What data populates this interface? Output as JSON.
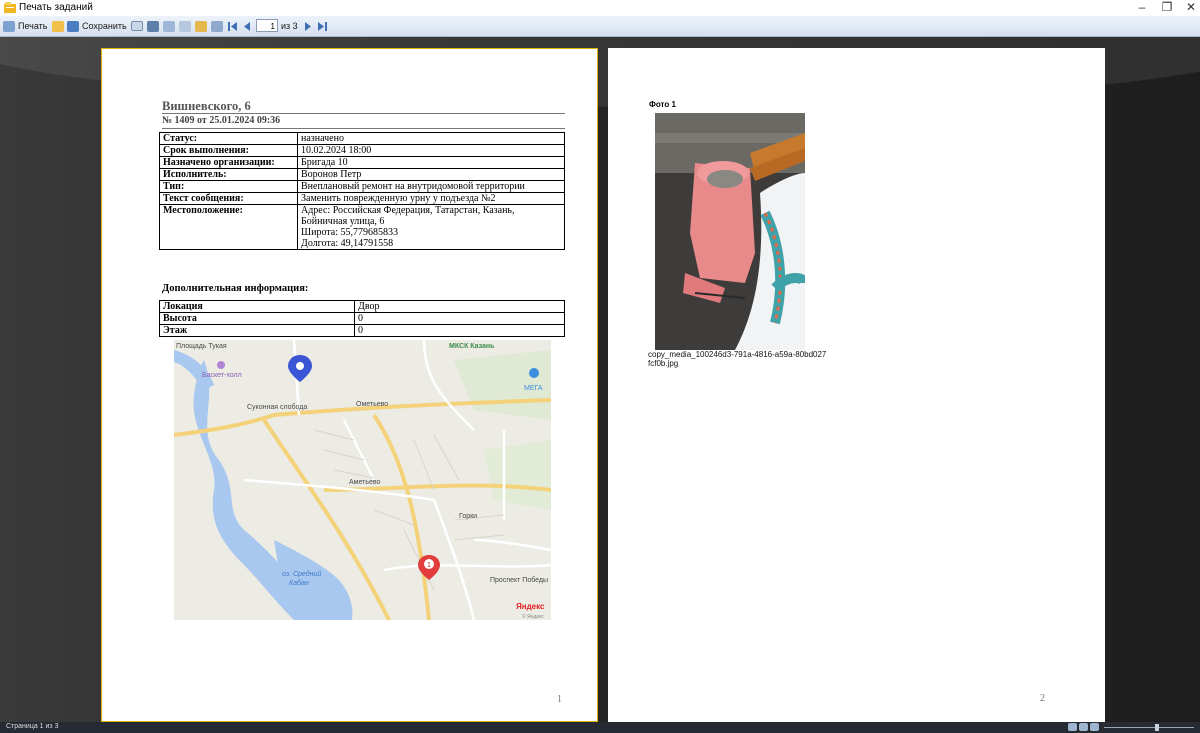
{
  "window": {
    "title": "Печать заданий",
    "minimize": "–",
    "restore": "❐",
    "close": "✕"
  },
  "toolbar": {
    "print_label": "Печать",
    "save_label": "Сохранить",
    "dropdown_arrow": "▾",
    "page_current": "1",
    "page_of": "из 3"
  },
  "page1": {
    "address": "Вишневского, 6",
    "number_line": "№ 1409 от 25.01.2024 09:36",
    "rows": [
      {
        "label": "Статус:",
        "value": "назначено"
      },
      {
        "label": "Срок выполнения:",
        "value": "10.02.2024 18:00"
      },
      {
        "label": "Назначено организации:",
        "value": "Бригада 10"
      },
      {
        "label": "Исполнитель:",
        "value": "Воронов Петр"
      },
      {
        "label": "Тип:",
        "value": "Внеплановый ремонт на внутридомовой территории"
      },
      {
        "label": "Текст сообщения:",
        "value": "Заменить поврежденную урну у подъезда №2"
      }
    ],
    "location": {
      "label": "Местоположение:",
      "line1": "Адрес: Российская Федерация, Татарстан, Казань,",
      "line2": "Бойничная улица, 6",
      "line3": "Широта: 55,779685833",
      "line4": "Долгота: 49,14791558"
    },
    "extra_title": "Дополнительная информация:",
    "extra_rows": [
      {
        "label": "Локация",
        "value": "Двор"
      },
      {
        "label": "Высота",
        "value": "0"
      },
      {
        "label": "Этаж",
        "value": "0"
      }
    ],
    "map_labels": {
      "l1": "Площадь Тукая",
      "l2": "Баскет-холл",
      "l3": "Суконная слобода",
      "l4": "Ометьево",
      "l5": "Аметьево",
      "l6": "Горки",
      "l7": "оз. Средний",
      "l8": "Кабан",
      "l9": "Проспект Победы",
      "l10": "МКСК Казань",
      "l11": "МЕГА",
      "l12": "Яндекс",
      "l13": "© Яндекс",
      "marker_num": "1"
    },
    "page_number": "1"
  },
  "page2": {
    "photo_title": "Фото 1",
    "caption": "copy_media_100246d3-791a-4816-a59a-80bd027fcf0b.jpg",
    "page_number": "2"
  },
  "status": {
    "page_text": "Страница 1 из 3"
  },
  "colors": {
    "accent_border": "#e2b200",
    "viewer_bg": "#262626",
    "toolbar_bg": "#dfe8f4"
  }
}
